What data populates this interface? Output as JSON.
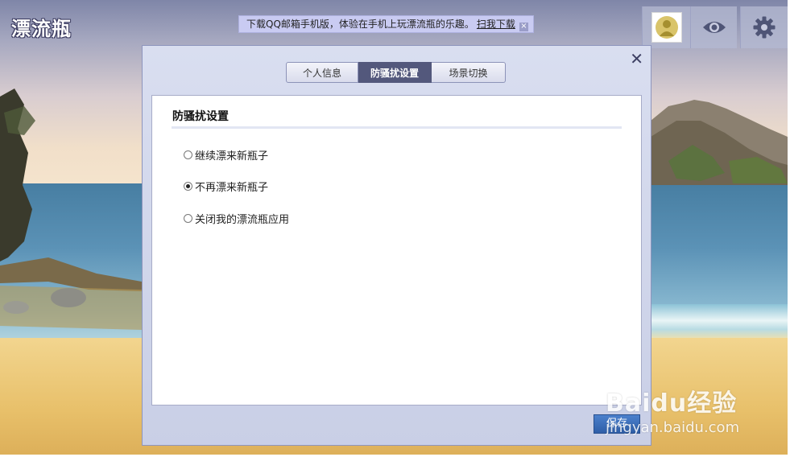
{
  "app": {
    "logo_text": "漂流瓶"
  },
  "notice": {
    "text": "下载QQ邮箱手机版，体验在手机上玩漂流瓶的乐趣。",
    "link_label": "扫我下载",
    "close_glyph": "×"
  },
  "toolbar": {
    "icons": [
      "avatar-icon",
      "eye-icon",
      "gear-icon"
    ]
  },
  "dialog": {
    "close_glyph": "✕",
    "tabs": [
      {
        "label": "个人信息",
        "active": false
      },
      {
        "label": "防骚扰设置",
        "active": true
      },
      {
        "label": "场景切换",
        "active": false
      }
    ],
    "panel_title": "防骚扰设置",
    "options": [
      {
        "label": "继续漂来新瓶子",
        "checked": false
      },
      {
        "label": "不再漂来新瓶子",
        "checked": true
      },
      {
        "label": "关闭我的漂流瓶应用",
        "checked": false
      }
    ],
    "save_label": "保存"
  },
  "watermark": {
    "brand": "Baidu经验",
    "url": "jingyan.baidu.com"
  },
  "colors": {
    "active_tab": "#53587c",
    "notice_bg": "#c9cbf2",
    "save_button": "#3a6dbb",
    "dialog_bg": "#d2d7ec"
  }
}
